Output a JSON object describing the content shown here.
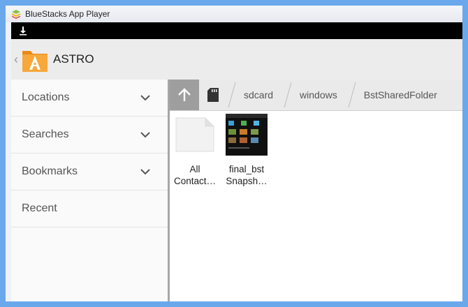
{
  "window": {
    "title": "BlueStacks App Player"
  },
  "app": {
    "title": "ASTRO"
  },
  "sidebar": {
    "items": [
      {
        "label": "Locations",
        "expandable": true
      },
      {
        "label": "Searches",
        "expandable": true
      },
      {
        "label": "Bookmarks",
        "expandable": true
      },
      {
        "label": "Recent",
        "expandable": false
      }
    ]
  },
  "path": {
    "crumbs": [
      "sdcard",
      "windows",
      "BstSharedFolder"
    ]
  },
  "files": [
    {
      "line1": "All",
      "line2": "Contact…",
      "icon": "blank-document-icon"
    },
    {
      "line1": "final_bst",
      "line2": "Snapsh…",
      "icon": "image-thumbnail"
    }
  ],
  "colors": {
    "accent": "#f29a1f",
    "desktop": "#6aa8ec"
  }
}
